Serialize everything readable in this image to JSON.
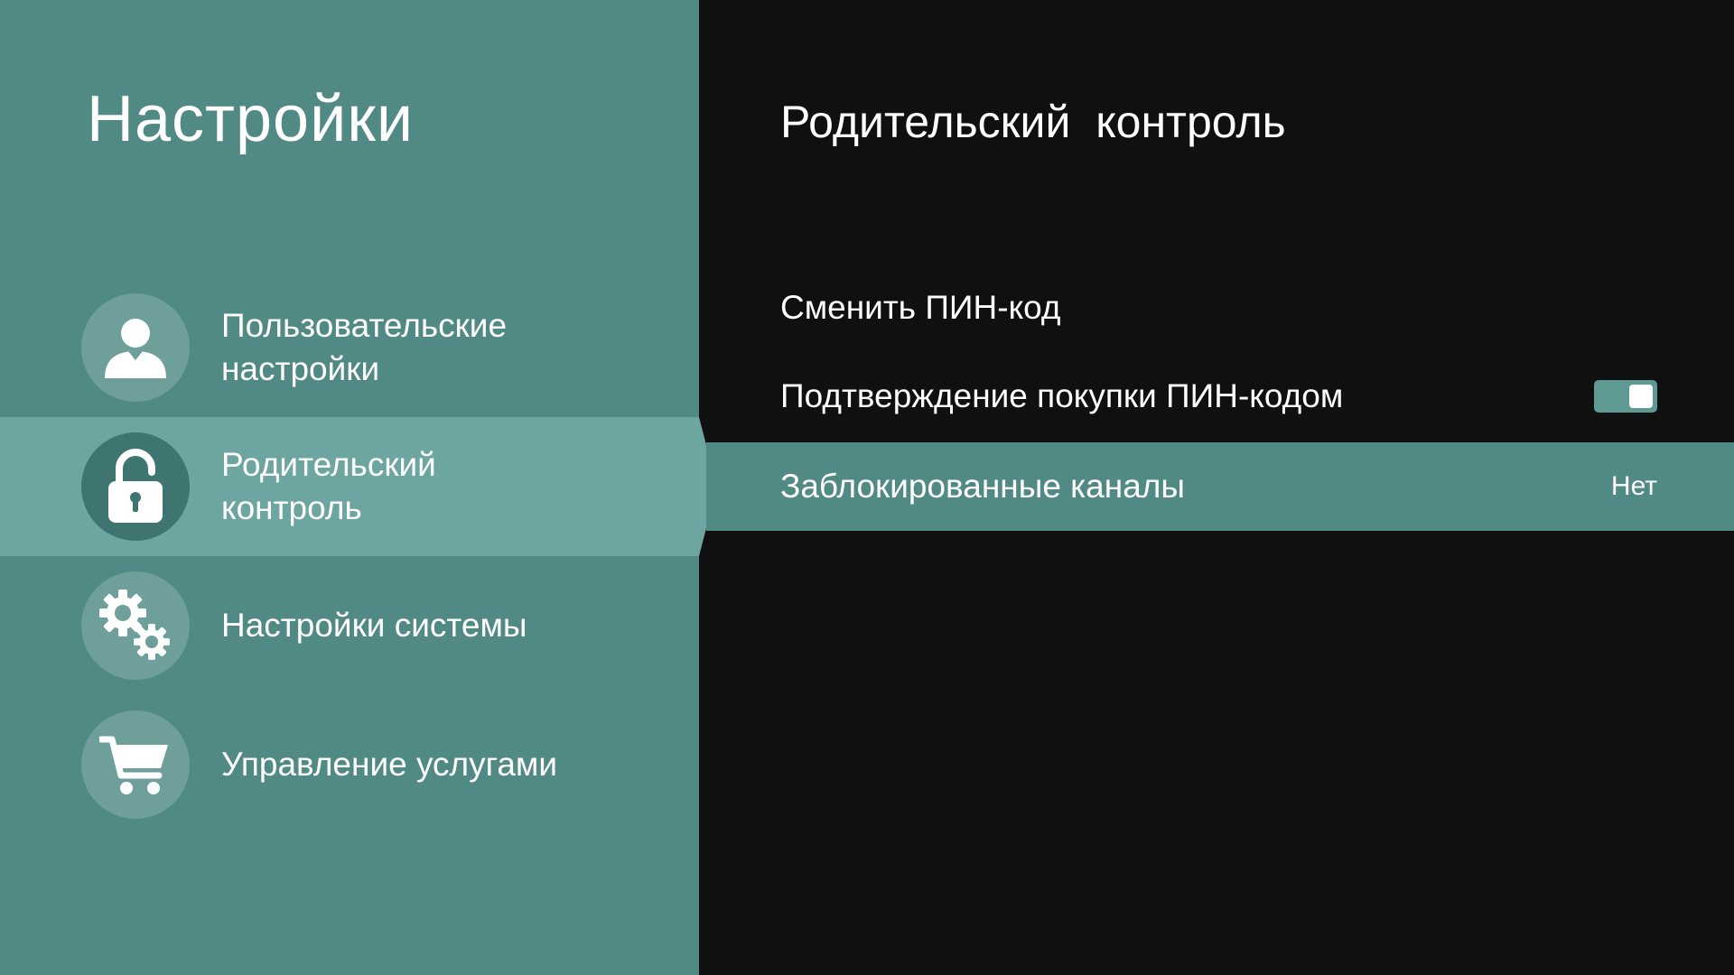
{
  "sidebar": {
    "title": "Настройки",
    "items": [
      {
        "label": "Пользовательские\nнастройки",
        "icon": "user-icon",
        "selected": false
      },
      {
        "label": "Родительский\nконтроль",
        "icon": "lock-icon",
        "selected": true
      },
      {
        "label": "Настройки системы",
        "icon": "gears-icon",
        "selected": false
      },
      {
        "label": "Управление услугами",
        "icon": "cart-icon",
        "selected": false
      }
    ]
  },
  "content": {
    "title": "Родительский  контроль",
    "options": [
      {
        "label": "Сменить ПИН-код"
      },
      {
        "label": "Подтверждение покупки ПИН-кодом",
        "control": "toggle",
        "state": "on"
      },
      {
        "label": "Заблокированные каналы",
        "value": "Нет",
        "highlighted": true
      }
    ]
  },
  "colors": {
    "sidebar_bg": "#518a85",
    "selected_bg": "#6da5a1",
    "content_bg": "#101010",
    "highlight_row": "#518a85",
    "toggle_on": "#5e9994"
  }
}
